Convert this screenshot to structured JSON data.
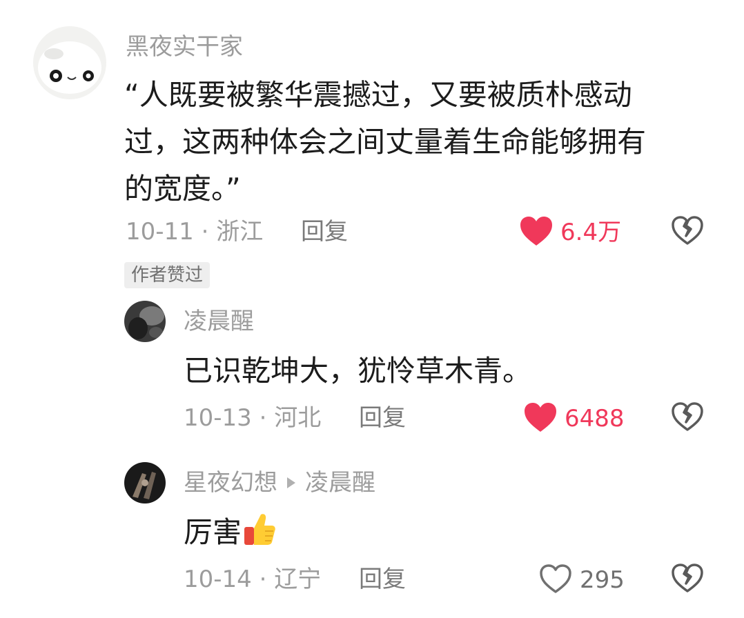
{
  "comment": {
    "username": "黑夜实干家",
    "lines": [
      "“人既要被繁华震撼过，又要被质朴感动",
      "过，这两种体会之间丈量着生命能够拥有",
      "的宽度。”"
    ],
    "meta": "10-11 · 浙江",
    "reply_label": "回复",
    "likes": "6.4万",
    "author_badge": "作者赞过"
  },
  "replies": [
    {
      "username": "凌晨醒",
      "text": "已识乾坤大，犹怜草木青。",
      "meta": "10-13 · 河北",
      "reply_label": "回复",
      "likes": "6488",
      "liked": true
    },
    {
      "username": "星夜幻想",
      "reply_to": "凌晨醒",
      "text": "厉害",
      "emoji": "thumbs-up-emoji",
      "meta": "10-14 · 辽宁",
      "reply_label": "回复",
      "likes": "295",
      "liked": false
    }
  ],
  "colors": {
    "like_active": "#f0385a",
    "meta_text": "#9c9c9c",
    "body_text": "#1c1c1c"
  }
}
